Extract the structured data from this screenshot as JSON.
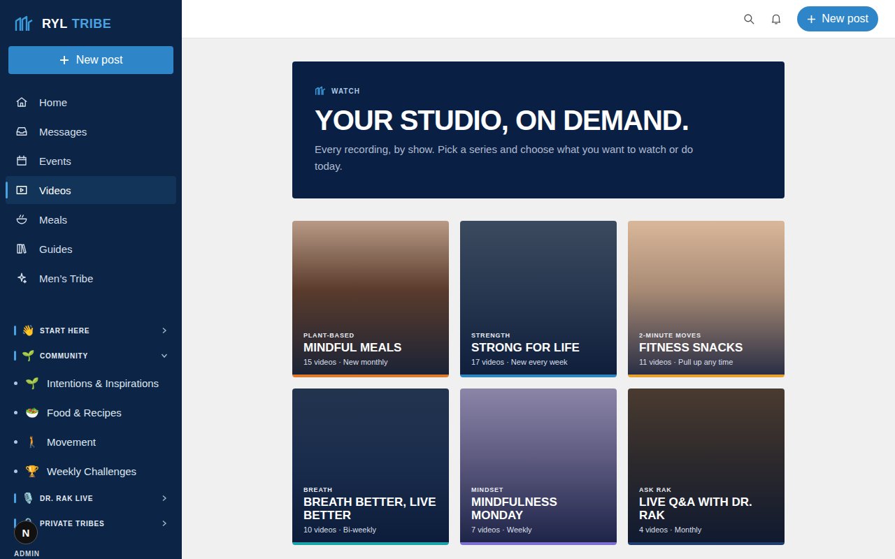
{
  "sidebar": {
    "logo": {
      "primary": "RYL",
      "secondary": "TRIBE"
    },
    "new_post_button": {
      "label": "New post"
    },
    "nav": [
      {
        "label": "Home",
        "selected": false
      },
      {
        "label": "Messages",
        "selected": false
      },
      {
        "label": "Events",
        "selected": false
      },
      {
        "label": "Videos",
        "selected": true
      },
      {
        "label": "Meals",
        "selected": false
      },
      {
        "label": "Guides",
        "selected": false
      },
      {
        "label": "Men’s Tribe",
        "selected": false
      }
    ],
    "sections": [
      {
        "icon": "👋",
        "label": "START HERE",
        "expanded": false,
        "channels": []
      },
      {
        "icon": "🌱",
        "label": "COMMUNITY",
        "expanded": true,
        "channels": [
          {
            "icon": "🌱",
            "label": "Intentions & Inspirations"
          },
          {
            "icon": "🥗",
            "label": "Food & Recipes"
          },
          {
            "icon": "🚶",
            "label": "Movement"
          },
          {
            "icon": "🏆",
            "label": "Weekly Challenges"
          }
        ]
      },
      {
        "icon": "🎙️",
        "label": "DR. RAK LIVE",
        "expanded": false,
        "channels": []
      },
      {
        "icon": "🔒",
        "label": "PRIVATE TRIBES",
        "expanded": false,
        "channels": []
      }
    ],
    "footer_label": "ADMIN",
    "avatar": "N"
  },
  "topbar": {
    "new_post_button": {
      "label": "New post"
    }
  },
  "hero": {
    "eyebrow": "WATCH",
    "title": "YOUR STUDIO, ON DEMAND.",
    "subtitle": "Every recording, by show. Pick a series and choose what you want to watch or do today."
  },
  "series": [
    {
      "category": "PLANT-BASED",
      "title": "MINDFUL MEALS",
      "meta": "15 videos · New monthly",
      "color": "#e07b2e"
    },
    {
      "category": "STRENGTH",
      "title": "STRONG FOR LIFE",
      "meta": "17 videos · New every week",
      "color": "#2e86c1"
    },
    {
      "category": "2-MINUTE MOVES",
      "title": "FITNESS SNACKS",
      "meta": "11 videos · Pull up any time",
      "color": "#e8a02f"
    },
    {
      "category": "BREATH",
      "title": "BREATH BETTER, LIVE BETTER",
      "meta": "10 videos · Bi-weekly",
      "color": "#1aa3a8"
    },
    {
      "category": "MINDSET",
      "title": "MINDFULNESS MONDAY",
      "meta": "7 videos · Weekly",
      "color": "#7c6fd1"
    },
    {
      "category": "ASK RAK",
      "title": "LIVE Q&A WITH DR. RAK",
      "meta": "4 videos · Monthly",
      "color": "#1f3d6e"
    }
  ]
}
